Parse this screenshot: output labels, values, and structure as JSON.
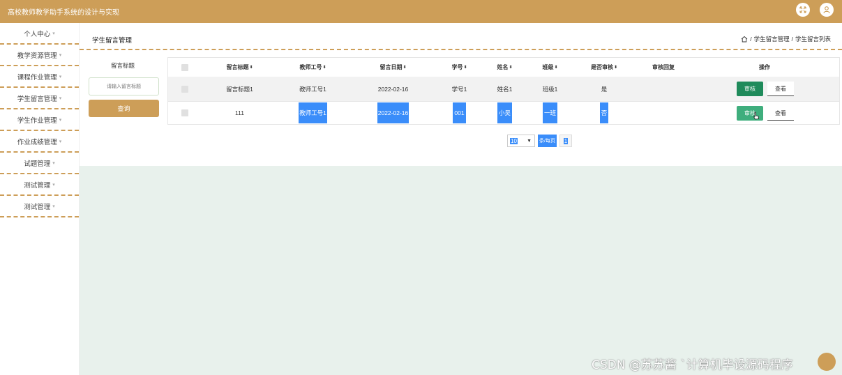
{
  "app": {
    "title": "高校教师教学助手系统的设计与实现"
  },
  "sidebar": {
    "items": [
      {
        "label": "个人中心"
      },
      {
        "label": "教学资源管理"
      },
      {
        "label": "课程作业管理"
      },
      {
        "label": "学生留言管理"
      },
      {
        "label": "学生作业管理"
      },
      {
        "label": "作业成绩管理"
      },
      {
        "label": "试题管理"
      },
      {
        "label": "测试管理"
      },
      {
        "label": "测试管理"
      }
    ]
  },
  "header": {
    "page_title": "学生留言管理",
    "breadcrumb": [
      "学生留言管理",
      "学生留言列表"
    ]
  },
  "search": {
    "label": "留言标题",
    "placeholder": "请输入留言标题",
    "button": "查询"
  },
  "table": {
    "columns": [
      "留言标题",
      "教师工号",
      "留言日期",
      "学号",
      "姓名",
      "班级",
      "是否审核",
      "审核回复",
      "操作"
    ],
    "sortable": [
      true,
      true,
      true,
      true,
      true,
      true,
      true,
      false,
      false
    ],
    "rows": [
      {
        "title": "留言标题1",
        "teacher_no": "教师工号1",
        "date": "2022-02-16",
        "student_no": "学号1",
        "name": "姓名1",
        "class": "班级1",
        "reviewed": "是",
        "reply": "",
        "audit_label": "审核",
        "view_label": "查看"
      },
      {
        "title": "111",
        "teacher_no": "教师工号1",
        "date": "2022-02-16",
        "student_no": "001",
        "name": "小吴",
        "class": "一班",
        "reviewed": "否",
        "reply": "",
        "audit_label": "审核",
        "view_label": "查看"
      }
    ]
  },
  "pagination": {
    "page_size": "10",
    "per_page_label": "条/每页",
    "current_page": "1"
  },
  "watermark": "CSDN @苏苏酱   `计算机毕设源码程序",
  "colors": {
    "brand": "#cd9e58",
    "audit_button": "#1f8b5b",
    "selection": "#3a8dfa",
    "content_bg": "#e8f1ec"
  },
  "icons": [
    "fullscreen-icon",
    "user-icon",
    "home-icon",
    "chevron-down-icon",
    "hand-cursor-icon"
  ]
}
